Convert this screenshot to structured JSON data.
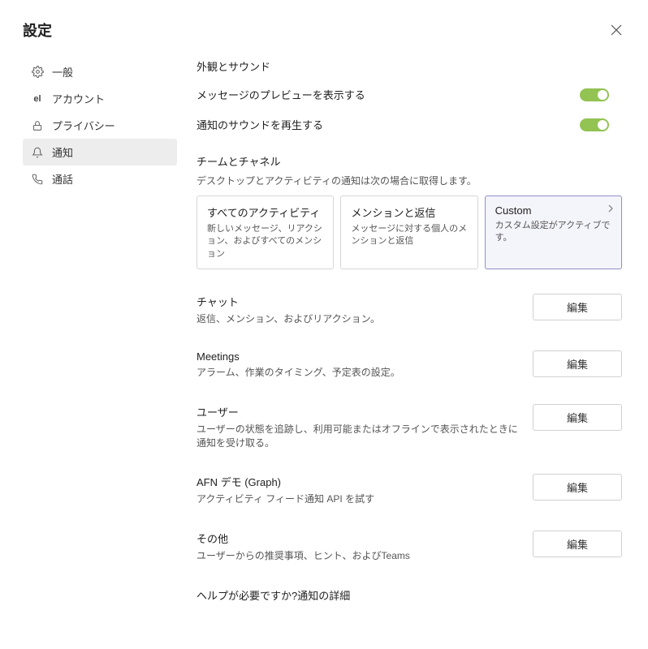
{
  "header": {
    "title": "設定"
  },
  "sidebar": {
    "items": [
      {
        "label": "一般"
      },
      {
        "label": "アカウント"
      },
      {
        "label": "プライバシー"
      },
      {
        "label": "通知"
      },
      {
        "label": "通話"
      }
    ]
  },
  "main": {
    "appearance": {
      "title": "外観とサウンド",
      "preview": "メッセージのプレビューを表示する",
      "sound": "通知のサウンドを再生する"
    },
    "teams": {
      "title": "チームとチャネル",
      "desc": "デスクトップとアクティビティの通知は次の場合に取得します。",
      "cards": [
        {
          "title": "すべてのアクティビティ",
          "desc": "新しいメッセージ、リアクション、およびすべてのメンション"
        },
        {
          "title": "メンションと返信",
          "desc": "メッセージに対する個人のメンションと返信"
        },
        {
          "title": "Custom",
          "desc": "カスタム設定がアクティブです。"
        }
      ]
    },
    "rows": [
      {
        "title": "チャット",
        "desc": "返信、メンション、およびリアクション。",
        "btn": "編集"
      },
      {
        "title": "Meetings",
        "desc": "アラーム、作業のタイミング、予定表の設定。",
        "btn": "編集"
      },
      {
        "title": "ユーザー",
        "desc": "ユーザーの状態を追跡し、利用可能またはオフラインで表示されたときに通知を受け取る。",
        "btn": "編集"
      },
      {
        "title": "AFN デモ (Graph)",
        "desc": "アクティビティ フィード通知 API を試す",
        "btn": "編集"
      },
      {
        "title": "その他",
        "desc": "ユーザーからの推奨事項、ヒント、およびTeams",
        "btn": "編集"
      }
    ],
    "help": "ヘルプが必要ですか?通知の詳細"
  }
}
